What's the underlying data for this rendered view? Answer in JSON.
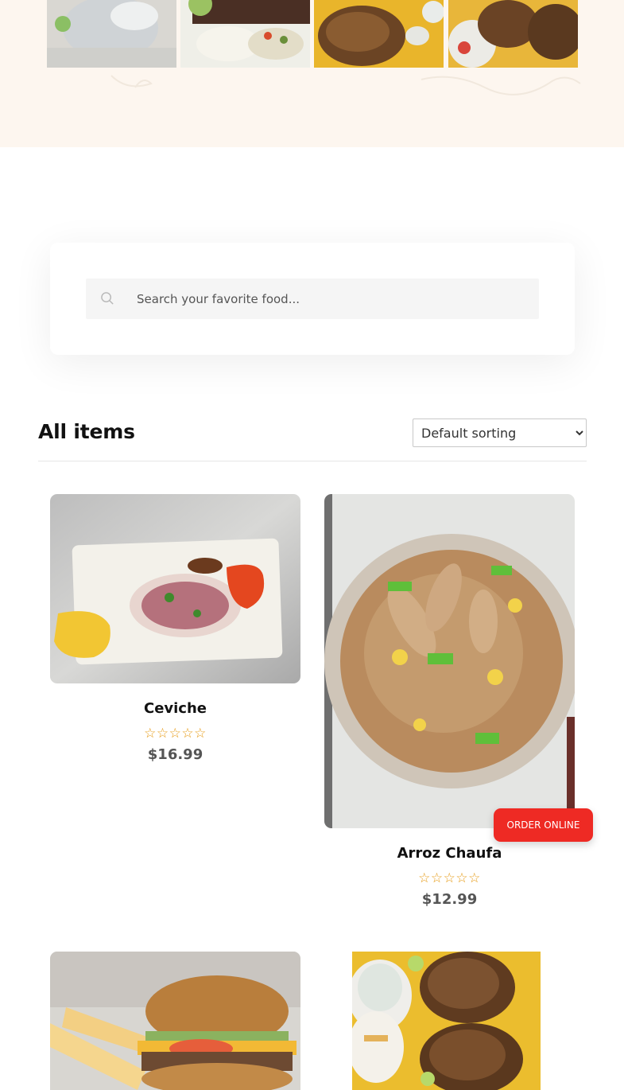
{
  "search": {
    "placeholder": "Search your favorite food..."
  },
  "listing": {
    "heading": "All items",
    "sort_selected": "Default sorting"
  },
  "products": [
    {
      "name": "Ceviche",
      "price": "$16.99",
      "rating": "☆☆☆☆☆"
    },
    {
      "name": "Arroz Chaufa",
      "price": "$12.99",
      "rating": "☆☆☆☆☆"
    }
  ],
  "order_button": {
    "label": "ORDER ONLINE"
  },
  "colors": {
    "banner_bg": "#fdf6ef",
    "accent_red": "#ee2a24",
    "star_orange": "#e69a13"
  }
}
